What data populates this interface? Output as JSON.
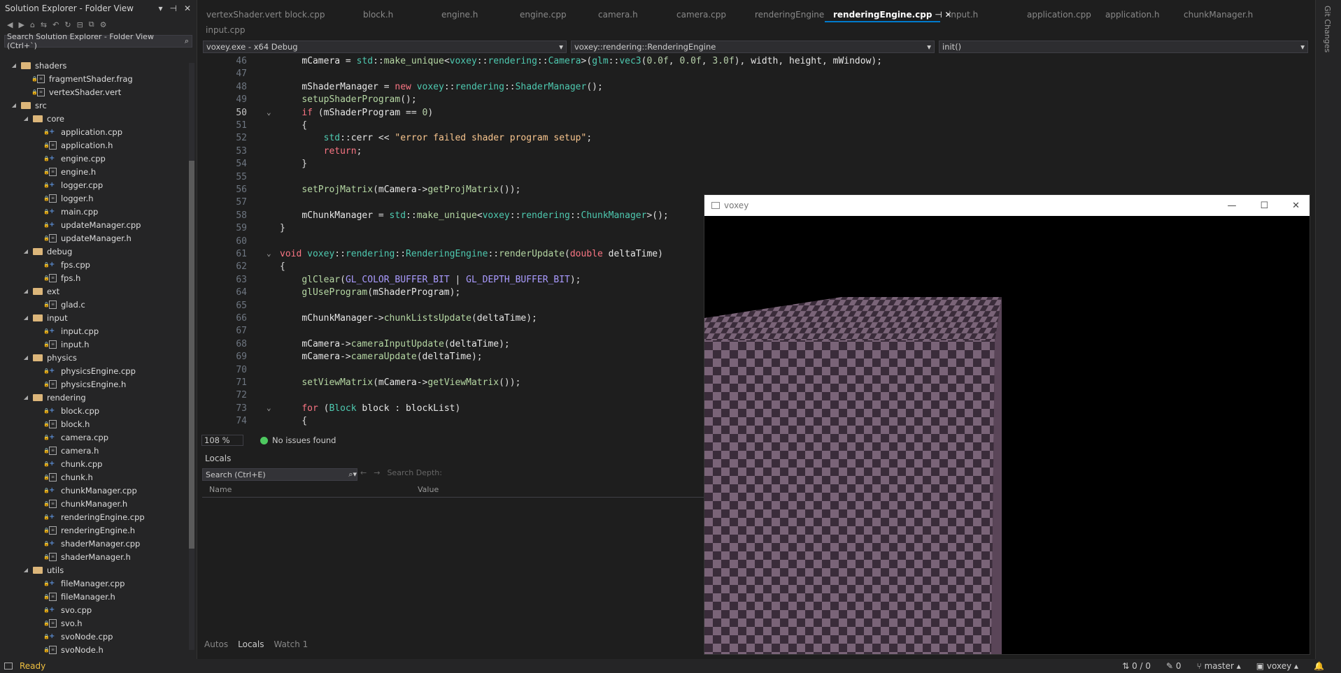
{
  "solution_explorer": {
    "title": "Solution Explorer - Folder View",
    "search_placeholder": "Search Solution Explorer - Folder View (Ctrl+`)",
    "tree": [
      {
        "label": "shaders",
        "type": "folder",
        "indent": 0
      },
      {
        "label": "fragmentShader.frag",
        "type": "file",
        "indent": 1
      },
      {
        "label": "vertexShader.vert",
        "type": "file",
        "indent": 1
      },
      {
        "label": "src",
        "type": "folder",
        "indent": 0
      },
      {
        "label": "core",
        "type": "folder",
        "indent": 1
      },
      {
        "label": "application.cpp",
        "type": "cpp",
        "indent": 2
      },
      {
        "label": "application.h",
        "type": "file",
        "indent": 2
      },
      {
        "label": "engine.cpp",
        "type": "cpp",
        "indent": 2
      },
      {
        "label": "engine.h",
        "type": "file",
        "indent": 2
      },
      {
        "label": "logger.cpp",
        "type": "cpp",
        "indent": 2
      },
      {
        "label": "logger.h",
        "type": "file",
        "indent": 2
      },
      {
        "label": "main.cpp",
        "type": "cpp",
        "indent": 2
      },
      {
        "label": "updateManager.cpp",
        "type": "cpp",
        "indent": 2
      },
      {
        "label": "updateManager.h",
        "type": "file",
        "indent": 2
      },
      {
        "label": "debug",
        "type": "folder",
        "indent": 1
      },
      {
        "label": "fps.cpp",
        "type": "cpp",
        "indent": 2
      },
      {
        "label": "fps.h",
        "type": "file",
        "indent": 2
      },
      {
        "label": "ext",
        "type": "folder",
        "indent": 1
      },
      {
        "label": "glad.c",
        "type": "file",
        "indent": 2
      },
      {
        "label": "input",
        "type": "folder",
        "indent": 1
      },
      {
        "label": "input.cpp",
        "type": "cpp",
        "indent": 2
      },
      {
        "label": "input.h",
        "type": "file",
        "indent": 2
      },
      {
        "label": "physics",
        "type": "folder",
        "indent": 1
      },
      {
        "label": "physicsEngine.cpp",
        "type": "cpp",
        "indent": 2
      },
      {
        "label": "physicsEngine.h",
        "type": "file",
        "indent": 2
      },
      {
        "label": "rendering",
        "type": "folder",
        "indent": 1
      },
      {
        "label": "block.cpp",
        "type": "cpp",
        "indent": 2
      },
      {
        "label": "block.h",
        "type": "file",
        "indent": 2
      },
      {
        "label": "camera.cpp",
        "type": "cpp",
        "indent": 2
      },
      {
        "label": "camera.h",
        "type": "file",
        "indent": 2
      },
      {
        "label": "chunk.cpp",
        "type": "cpp",
        "indent": 2
      },
      {
        "label": "chunk.h",
        "type": "file",
        "indent": 2
      },
      {
        "label": "chunkManager.cpp",
        "type": "cpp",
        "indent": 2
      },
      {
        "label": "chunkManager.h",
        "type": "file",
        "indent": 2
      },
      {
        "label": "renderingEngine.cpp",
        "type": "cpp",
        "indent": 2
      },
      {
        "label": "renderingEngine.h",
        "type": "file",
        "indent": 2
      },
      {
        "label": "shaderManager.cpp",
        "type": "cpp",
        "indent": 2
      },
      {
        "label": "shaderManager.h",
        "type": "file",
        "indent": 2
      },
      {
        "label": "utils",
        "type": "folder",
        "indent": 1
      },
      {
        "label": "fileManager.cpp",
        "type": "cpp",
        "indent": 2
      },
      {
        "label": "fileManager.h",
        "type": "file",
        "indent": 2
      },
      {
        "label": "svo.cpp",
        "type": "cpp",
        "indent": 2
      },
      {
        "label": "svo.h",
        "type": "file",
        "indent": 2
      },
      {
        "label": "svoNode.cpp",
        "type": "cpp",
        "indent": 2
      },
      {
        "label": "svoNode.h",
        "type": "file",
        "indent": 2
      }
    ]
  },
  "tabs": [
    "vertexShader.vert",
    "block.cpp",
    "block.h",
    "engine.h",
    "engine.cpp",
    "camera.h",
    "camera.cpp",
    "renderingEngine.h",
    "renderingEngine.cpp",
    "input.h",
    "application.cpp",
    "application.h",
    "chunkManager.h"
  ],
  "active_tab": "renderingEngine.cpp",
  "tabs_row2": [
    "input.cpp"
  ],
  "nav": {
    "project": "voxey.exe - x64 Debug",
    "scope": "voxey::rendering::RenderingEngine",
    "member": "init()"
  },
  "code_lines": [
    {
      "n": "46",
      "h": "    <span class='var'>mCamera</span> = <span class='ty'>std</span>::<span class='fn'>make_unique</span>&lt;<span class='ty'>voxey</span>::<span class='ty'>rendering</span>::<span class='ty'>Camera</span>&gt;(<span class='ty'>glm</span>::<span class='ty'>vec3</span>(<span class='num'>0.0f</span>, <span class='num'>0.0f</span>, <span class='num'>3.0f</span>), <span class='var'>width</span>, <span class='var'>height</span>, <span class='var'>mWindow</span>);"
    },
    {
      "n": "47",
      "h": ""
    },
    {
      "n": "48",
      "h": "    <span class='var'>mShaderManager</span> = <span class='kw'>new</span> <span class='ty'>voxey</span>::<span class='ty'>rendering</span>::<span class='ty'>ShaderManager</span>();"
    },
    {
      "n": "49",
      "h": "    <span class='fn'>setupShaderProgram</span>();"
    },
    {
      "n": "50",
      "h": "    <span class='kw'>if</span> (<span class='var'>mShaderProgram</span> == <span class='num'>0</span>)",
      "cur": true
    },
    {
      "n": "51",
      "h": "    {"
    },
    {
      "n": "52",
      "h": "        <span class='ty'>std</span>::<span class='var'>cerr</span> &lt;&lt; <span class='str'>\"error failed shader program setup\"</span>;"
    },
    {
      "n": "53",
      "h": "        <span class='kw'>return</span>;"
    },
    {
      "n": "54",
      "h": "    }"
    },
    {
      "n": "55",
      "h": ""
    },
    {
      "n": "56",
      "h": "    <span class='fn'>setProjMatrix</span>(<span class='var'>mCamera</span>-&gt;<span class='fn'>getProjMatrix</span>());"
    },
    {
      "n": "57",
      "h": ""
    },
    {
      "n": "58",
      "h": "    <span class='var'>mChunkManager</span> = <span class='ty'>std</span>::<span class='fn'>make_unique</span>&lt;<span class='ty'>voxey</span>::<span class='ty'>rendering</span>::<span class='ty'>ChunkManager</span>&gt;();"
    },
    {
      "n": "59",
      "h": "}"
    },
    {
      "n": "60",
      "h": ""
    },
    {
      "n": "61",
      "h": "<span class='kw'>void</span> <span class='ty'>voxey</span>::<span class='ty'>rendering</span>::<span class='ty'>RenderingEngine</span>::<span class='fn'>renderUpdate</span>(<span class='kw'>double</span> <span class='var'>deltaTime</span>)"
    },
    {
      "n": "62",
      "h": "{"
    },
    {
      "n": "63",
      "h": "    <span class='fn'>glClear</span>(<span class='mac'>GL_COLOR_BUFFER_BIT</span> | <span class='mac'>GL_DEPTH_BUFFER_BIT</span>);"
    },
    {
      "n": "64",
      "h": "    <span class='fn'>glUseProgram</span>(<span class='var'>mShaderProgram</span>);"
    },
    {
      "n": "65",
      "h": ""
    },
    {
      "n": "66",
      "h": "    <span class='var'>mChunkManager</span>-&gt;<span class='fn'>chunkListsUpdate</span>(<span class='var'>deltaTime</span>);"
    },
    {
      "n": "67",
      "h": ""
    },
    {
      "n": "68",
      "h": "    <span class='var'>mCamera</span>-&gt;<span class='fn'>cameraInputUpdate</span>(<span class='var'>deltaTime</span>);"
    },
    {
      "n": "69",
      "h": "    <span class='var'>mCamera</span>-&gt;<span class='fn'>cameraUpdate</span>(<span class='var'>deltaTime</span>);"
    },
    {
      "n": "70",
      "h": ""
    },
    {
      "n": "71",
      "h": "    <span class='fn'>setViewMatrix</span>(<span class='var'>mCamera</span>-&gt;<span class='fn'>getViewMatrix</span>());"
    },
    {
      "n": "72",
      "h": ""
    },
    {
      "n": "73",
      "h": "    <span class='kw'>for</span> (<span class='ty'>Block</span> <span class='var'>block</span> : <span class='var'>blockList</span>)"
    },
    {
      "n": "74",
      "h": "    {"
    }
  ],
  "editor_status": {
    "zoom": "108 %",
    "issues": "No issues found"
  },
  "locals": {
    "title": "Locals",
    "search_placeholder": "Search (Ctrl+E)",
    "search_depth_label": "Search Depth:",
    "col_name": "Name",
    "col_value": "Value"
  },
  "bottom_tabs": [
    "Autos",
    "Locals",
    "Watch 1"
  ],
  "status": {
    "ready": "Ready",
    "changes": "0 / 0",
    "errors": "0",
    "branch": "master",
    "repo": "voxey"
  },
  "voxey_window": {
    "title": "voxey"
  },
  "right_sidebar": {
    "label": "Git Changes"
  }
}
